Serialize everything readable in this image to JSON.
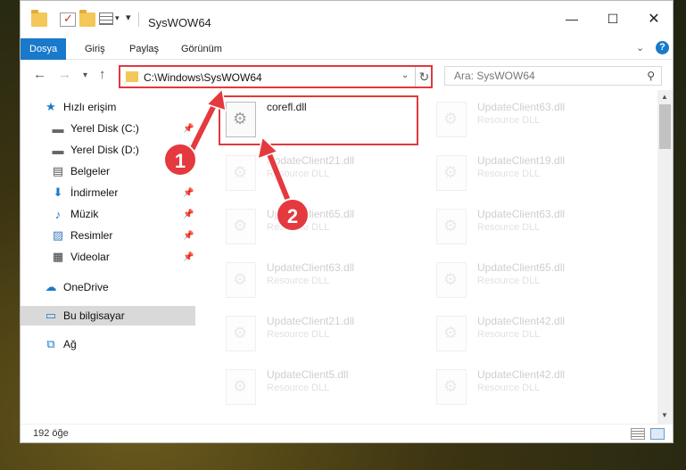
{
  "window": {
    "title": "SysWOW64"
  },
  "ribbon": {
    "tabs": [
      "Dosya",
      "Giriş",
      "Paylaş",
      "Görünüm"
    ]
  },
  "address": {
    "path": "C:\\Windows\\SysWOW64",
    "refresh_icon": "refresh-icon"
  },
  "search": {
    "placeholder": "Ara: SysWOW64"
  },
  "sidebar": {
    "items": [
      {
        "label": "Hızlı erişim",
        "icon": "star-icon",
        "pinned": false
      },
      {
        "label": "Yerel Disk (C:)",
        "icon": "drive-icon",
        "pinned": true
      },
      {
        "label": "Yerel Disk (D:)",
        "icon": "drive-icon",
        "pinned": true
      },
      {
        "label": "Belgeler",
        "icon": "documents-icon",
        "pinned": true
      },
      {
        "label": "İndirmeler",
        "icon": "download-icon",
        "pinned": true
      },
      {
        "label": "Müzik",
        "icon": "music-icon",
        "pinned": true
      },
      {
        "label": "Resimler",
        "icon": "pictures-icon",
        "pinned": true
      },
      {
        "label": "Videolar",
        "icon": "video-icon",
        "pinned": true
      },
      {
        "label": "OneDrive",
        "icon": "cloud-icon",
        "pinned": false
      },
      {
        "label": "Bu bilgisayar",
        "icon": "computer-icon",
        "pinned": false
      },
      {
        "label": "Ağ",
        "icon": "network-icon",
        "pinned": false
      }
    ]
  },
  "files": {
    "highlighted": {
      "name": "corefl.dll",
      "desc": ""
    },
    "left_column": [
      {
        "name": "UpdateClient21.dll",
        "desc": "Resource DLL"
      },
      {
        "name": "UpdateClient65.dll",
        "desc": "Resource DLL"
      },
      {
        "name": "UpdateClient63.dll",
        "desc": "Resource DLL"
      },
      {
        "name": "UpdateClient21.dll",
        "desc": "Resource DLL"
      },
      {
        "name": "UpdateClient5.dll",
        "desc": "Resource DLL"
      }
    ],
    "right_column": [
      {
        "name": "UpdateClient63.dll",
        "desc": "Resource DLL"
      },
      {
        "name": "UpdateClient19.dll",
        "desc": "Resource DLL"
      },
      {
        "name": "UpdateClient63.dll",
        "desc": "Resource DLL"
      },
      {
        "name": "UpdateClient65.dll",
        "desc": "Resource DLL"
      },
      {
        "name": "UpdateClient42.dll",
        "desc": "Resource DLL"
      },
      {
        "name": "UpdateClient42.dll",
        "desc": "Resource DLL"
      }
    ]
  },
  "status": {
    "count": "192 öğe"
  },
  "callouts": [
    "1",
    "2"
  ],
  "colors": {
    "accent": "#1979ca",
    "highlight_red": "#e0393e",
    "selected_nav": "#d9d9d9"
  }
}
